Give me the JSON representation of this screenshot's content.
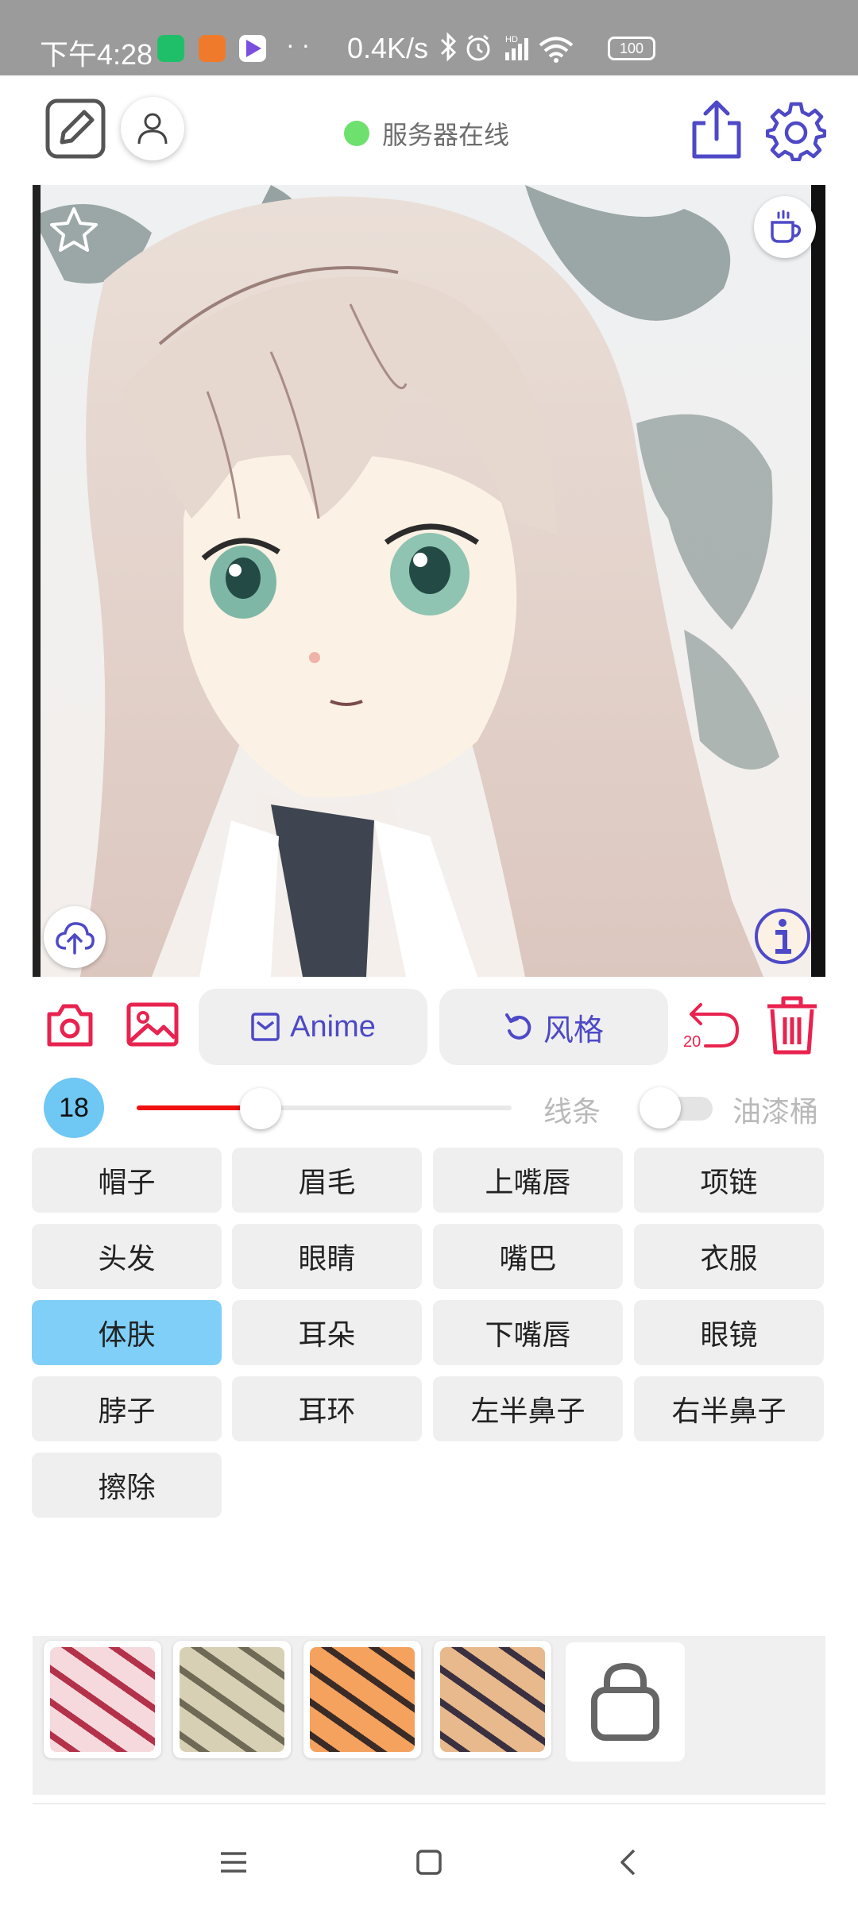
{
  "status_bar": {
    "time": "下午4:28",
    "dots": "· ·",
    "speed": "0.4K/s",
    "battery": "100",
    "network_badge": "HD"
  },
  "header": {
    "server_status": "服务器在线",
    "server_status_color": "#6ee06e",
    "icons": [
      "edit-icon",
      "user-icon",
      "share-icon",
      "settings-icon"
    ]
  },
  "canvas": {
    "icons": [
      "star-icon",
      "coffee-icon",
      "cloud-upload-icon",
      "info-icon"
    ]
  },
  "actions": {
    "anime_label": "Anime",
    "style_label": "风格",
    "undo_count": "20",
    "accent_color": "#e8234f",
    "primary_color": "#4d49c7"
  },
  "brush": {
    "size": "18",
    "slider_fraction": 0.33,
    "line_label": "线条",
    "bucket_label": "油漆桶",
    "bucket_enabled": false
  },
  "parts": [
    "帽子",
    "眉毛",
    "上嘴唇",
    "项链",
    "头发",
    "眼睛",
    "嘴巴",
    "衣服",
    "体肤",
    "耳朵",
    "下嘴唇",
    "眼镜",
    "脖子",
    "耳环",
    "左半鼻子",
    "右半鼻子",
    "擦除"
  ],
  "selected_part": "体肤",
  "swatches": [
    {
      "name": "pink-pattern",
      "colors": [
        "#f6d9dc",
        "#b3324a"
      ]
    },
    {
      "name": "khaki-pattern",
      "colors": [
        "#d8d0b4",
        "#6e6a55"
      ]
    },
    {
      "name": "orange-pattern",
      "colors": [
        "#f4a25e",
        "#3b2b26"
      ]
    },
    {
      "name": "dark-pattern",
      "colors": [
        "#e8b98c",
        "#3a3040"
      ]
    }
  ]
}
